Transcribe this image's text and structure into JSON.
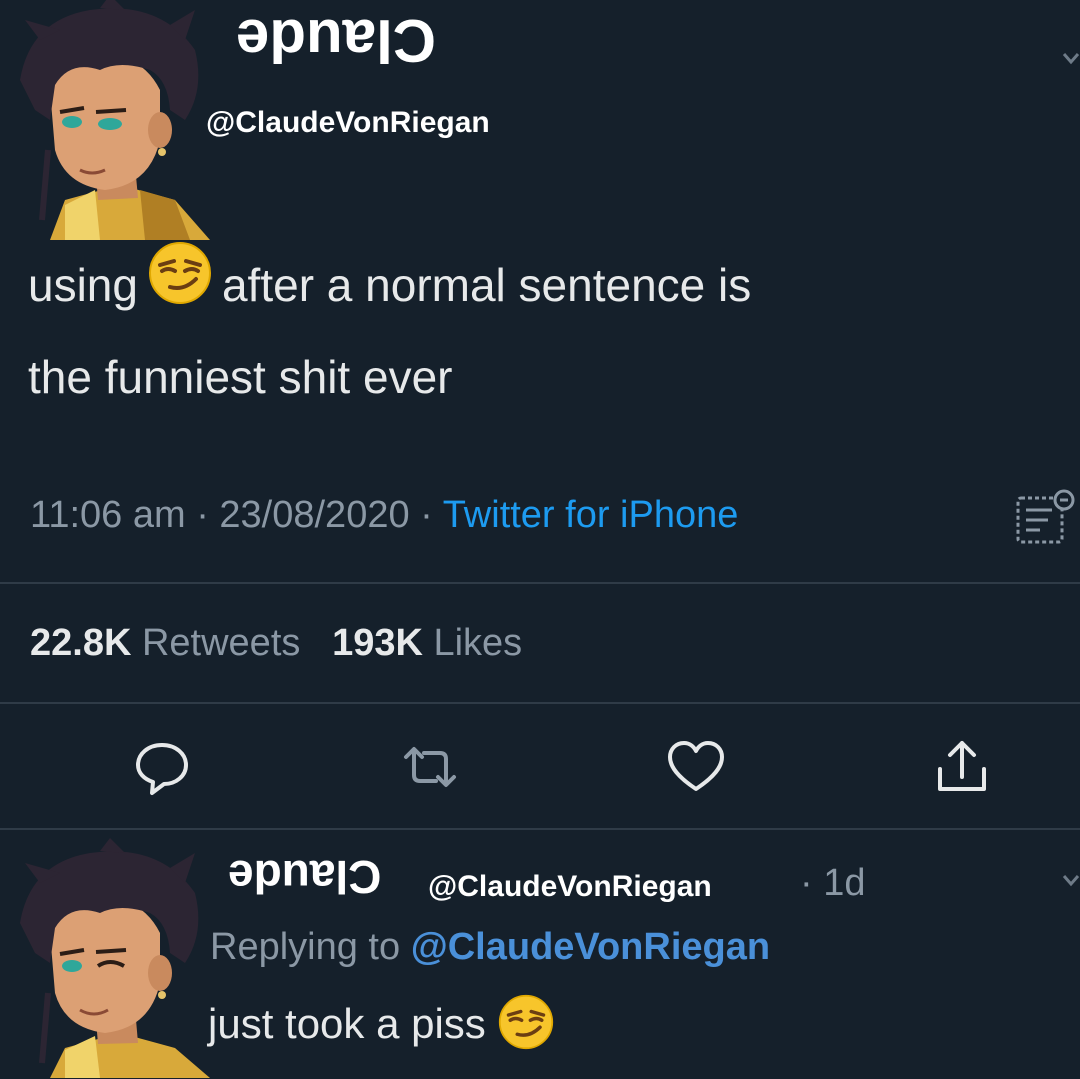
{
  "tweet": {
    "display_name": "Claude",
    "handle": "@ClaudeVonRiegan",
    "text_before_emoji": "using",
    "text_after_emoji": "after a normal sentence is",
    "text_line2": "the funniest shit ever",
    "emoji": "smirking-face",
    "time": "11:06 am",
    "date": "23/08/2020",
    "separator": "·",
    "source": "Twitter for iPhone",
    "retweets_count": "22.8K",
    "retweets_label": "Retweets",
    "likes_count": "193K",
    "likes_label": "Likes"
  },
  "actions": {
    "reply_icon": "speech-bubble-icon",
    "retweet_icon": "retweet-icon",
    "like_icon": "heart-icon",
    "share_icon": "share-icon"
  },
  "reply": {
    "display_name": "Claude",
    "handle": "@ClaudeVonRiegan",
    "age": "· 1d",
    "replying_to_label": "Replying to",
    "replying_to_handle": "@ClaudeVonRiegan",
    "text": "just took a piss",
    "emoji": "smirking-face"
  },
  "colors": {
    "background": "#15202b",
    "link": "#1d9bf0",
    "secondary_text": "#8b98a5",
    "mention": "#4a90d9"
  }
}
